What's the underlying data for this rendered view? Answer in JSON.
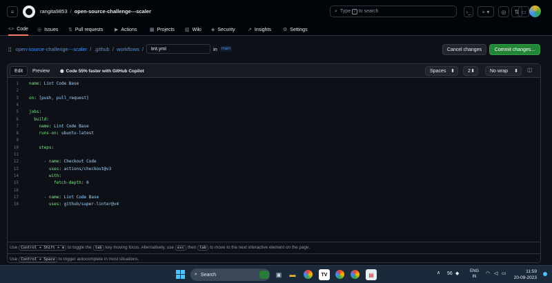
{
  "header": {
    "owner": "rangita9853",
    "repo": "open-source-challenge---scaler",
    "search_placeholder": "Type / to search",
    "search_prefix": "Type",
    "search_suffix": "to search",
    "search_slash": "/"
  },
  "repo_nav": {
    "tabs": [
      {
        "label": "Code",
        "icon": "code-icon",
        "active": true
      },
      {
        "label": "Issues",
        "icon": "issue-icon"
      },
      {
        "label": "Pull requests",
        "icon": "pull-request-icon"
      },
      {
        "label": "Actions",
        "icon": "play-icon"
      },
      {
        "label": "Projects",
        "icon": "table-icon"
      },
      {
        "label": "Wiki",
        "icon": "book-icon"
      },
      {
        "label": "Security",
        "icon": "shield-icon"
      },
      {
        "label": "Insights",
        "icon": "graph-icon"
      },
      {
        "label": "Settings",
        "icon": "gear-icon"
      }
    ]
  },
  "file_path": {
    "repo": "open-source-challenge---scaler",
    "dir1": ".github",
    "dir2": "workflows",
    "filename": "lint.yml",
    "in_label": "in",
    "branch": "main"
  },
  "actions": {
    "cancel": "Cancel changes",
    "commit": "Commit changes..."
  },
  "editor_toolbar": {
    "edit": "Edit",
    "preview": "Preview",
    "copilot": "Code 55% faster with GitHub Copilot",
    "indent_mode": "Spaces",
    "indent_size": "2",
    "wrap_mode": "No wrap"
  },
  "code_lines": [
    {
      "n": "1",
      "key": "name",
      "val": "Lint Code Base",
      "indent": 0
    },
    {
      "n": "2",
      "text": ""
    },
    {
      "n": "3",
      "key": "on",
      "val": "[push, pull_request]",
      "indent": 0
    },
    {
      "n": "4",
      "text": ""
    },
    {
      "n": "5",
      "key": "jobs",
      "val": "",
      "indent": 0
    },
    {
      "n": "6",
      "key": "build",
      "val": "",
      "indent": 2
    },
    {
      "n": "7",
      "key": "name",
      "val": "Lint Code Base",
      "indent": 4
    },
    {
      "n": "8",
      "key": "runs-on",
      "val": "ubuntu-latest",
      "indent": 4
    },
    {
      "n": "9",
      "text": ""
    },
    {
      "n": "10",
      "key": "steps",
      "val": "",
      "indent": 4
    },
    {
      "n": "11",
      "text": ""
    },
    {
      "n": "12",
      "key": "- name",
      "val": "Checkout Code",
      "indent": 6
    },
    {
      "n": "13",
      "key": "uses",
      "val": "actions/checkout@v3",
      "indent": 8
    },
    {
      "n": "14",
      "key": "with",
      "val": "",
      "indent": 8
    },
    {
      "n": "15",
      "key": "fetch-depth",
      "val": "0",
      "indent": 10
    },
    {
      "n": "16",
      "text": ""
    },
    {
      "n": "17",
      "key": "- name",
      "val": "Lint Code Base",
      "indent": 6
    },
    {
      "n": "18",
      "key": "uses",
      "val": "github/super-linter@v4",
      "indent": 8
    }
  ],
  "hints": {
    "line1_a": "Use",
    "line1_k1": "Control + Shift + m",
    "line1_b": "to toggle the",
    "line1_k2": "tab",
    "line1_c": "key moving focus. Alternatively, use",
    "line1_k3": "esc",
    "line1_d": "then",
    "line1_k4": "tab",
    "line1_e": "to move to the next interactive element on the page.",
    "line2_a": "Use",
    "line2_k1": "Control + Space",
    "line2_b": "to trigger autocomplete in most situations."
  },
  "taskbar": {
    "search": "Search",
    "volume": "56",
    "lang": "ENG",
    "lang_sub": "IN",
    "time": "11:59",
    "date": "20-09-2023"
  },
  "colors": {
    "accent_green": "#238636",
    "link_blue": "#4493f8",
    "yaml_key": "#7ee787",
    "yaml_value": "#a5d6ff",
    "active_tab_underline": "#f78166"
  }
}
